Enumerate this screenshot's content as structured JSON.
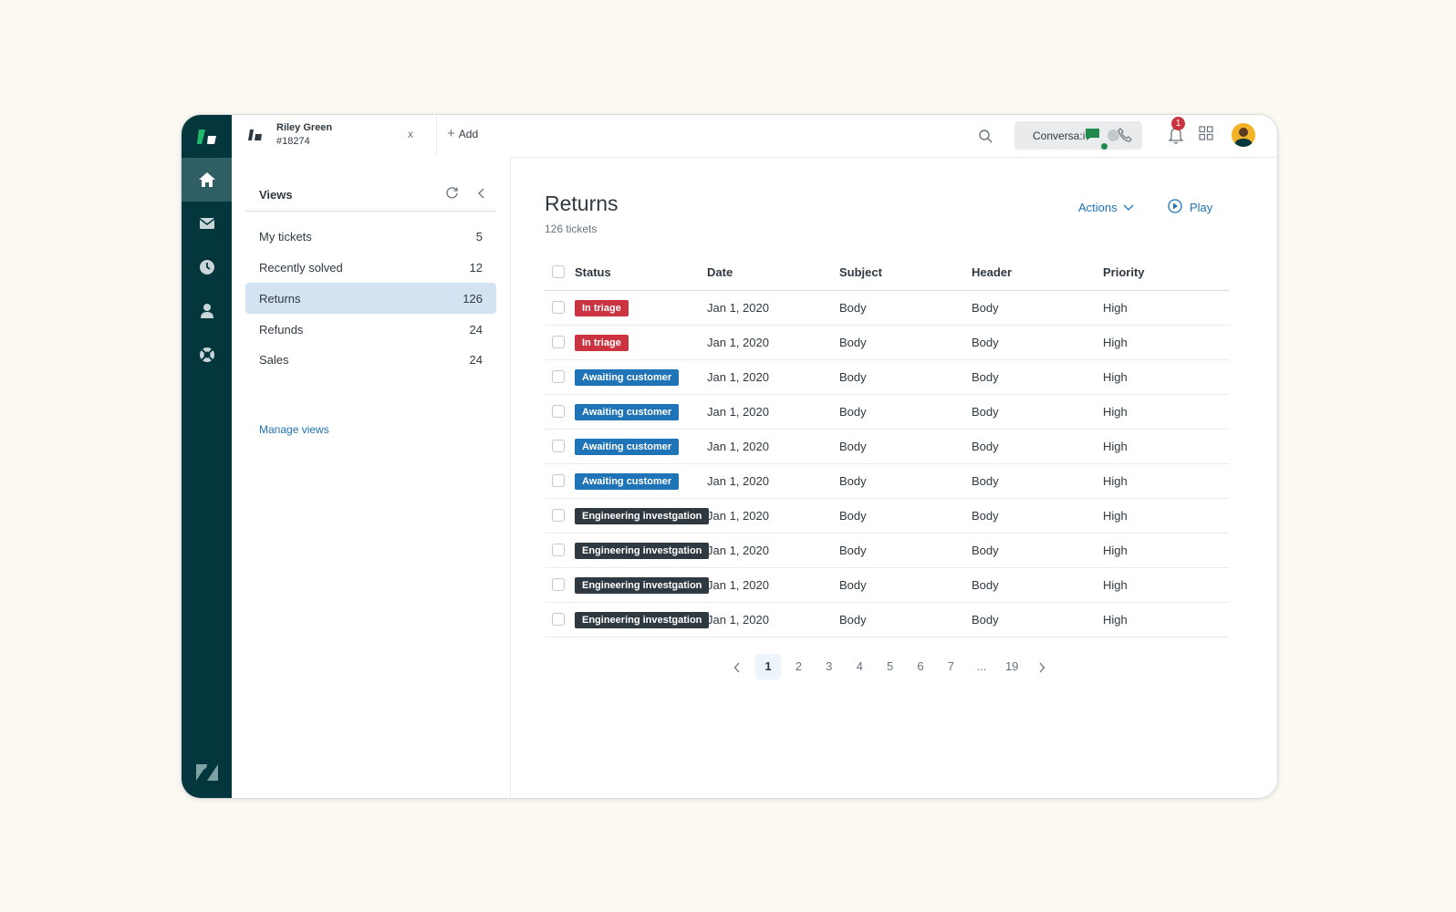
{
  "topbar": {
    "tab": {
      "title": "Riley Green",
      "subtitle": "#18274",
      "close": "x"
    },
    "add_label": "Add",
    "conversations_label": "Conversa:i",
    "notification_count": "1"
  },
  "rail": {
    "items": [
      "home-icon",
      "mail-icon",
      "clock-icon",
      "user-icon",
      "support-icon"
    ],
    "active": "home-icon"
  },
  "views": {
    "title": "Views",
    "items": [
      {
        "label": "My tickets",
        "count": "5"
      },
      {
        "label": "Recently solved",
        "count": "12"
      },
      {
        "label": "Returns",
        "count": "126"
      },
      {
        "label": "Refunds",
        "count": "24"
      },
      {
        "label": "Sales",
        "count": "24"
      }
    ],
    "active_index": 2,
    "manage_label": "Manage views"
  },
  "main": {
    "title": "Returns",
    "subtitle": "126 tickets",
    "actions_label": "Actions",
    "play_label": "Play",
    "columns": [
      "Status",
      "Date",
      "Subject",
      "Header",
      "Priority"
    ],
    "rows": [
      {
        "status": "In triage",
        "status_color": "#cc3340",
        "date": "Jan 1, 2020",
        "subject": "Body",
        "header": "Body",
        "priority": "High"
      },
      {
        "status": "In triage",
        "status_color": "#cc3340",
        "date": "Jan 1, 2020",
        "subject": "Body",
        "header": "Body",
        "priority": "High"
      },
      {
        "status": "Awaiting customer",
        "status_color": "#1f73b7",
        "date": "Jan 1, 2020",
        "subject": "Body",
        "header": "Body",
        "priority": "High"
      },
      {
        "status": "Awaiting customer",
        "status_color": "#1f73b7",
        "date": "Jan 1, 2020",
        "subject": "Body",
        "header": "Body",
        "priority": "High"
      },
      {
        "status": "Awaiting customer",
        "status_color": "#1f73b7",
        "date": "Jan 1, 2020",
        "subject": "Body",
        "header": "Body",
        "priority": "High"
      },
      {
        "status": "Awaiting customer",
        "status_color": "#1f73b7",
        "date": "Jan 1, 2020",
        "subject": "Body",
        "header": "Body",
        "priority": "High"
      },
      {
        "status": "Engineering investgation",
        "status_color": "#2f3941",
        "date": "Jan 1, 2020",
        "subject": "Body",
        "header": "Body",
        "priority": "High"
      },
      {
        "status": "Engineering investgation",
        "status_color": "#2f3941",
        "date": "Jan 1, 2020",
        "subject": "Body",
        "header": "Body",
        "priority": "High"
      },
      {
        "status": "Engineering investgation",
        "status_color": "#2f3941",
        "date": "Jan 1, 2020",
        "subject": "Body",
        "header": "Body",
        "priority": "High"
      },
      {
        "status": "Engineering investgation",
        "status_color": "#2f3941",
        "date": "Jan 1, 2020",
        "subject": "Body",
        "header": "Body",
        "priority": "High"
      }
    ],
    "pagination": {
      "pages": [
        "1",
        "2",
        "3",
        "4",
        "5",
        "6",
        "7",
        "...",
        "19"
      ],
      "current": "1"
    }
  }
}
